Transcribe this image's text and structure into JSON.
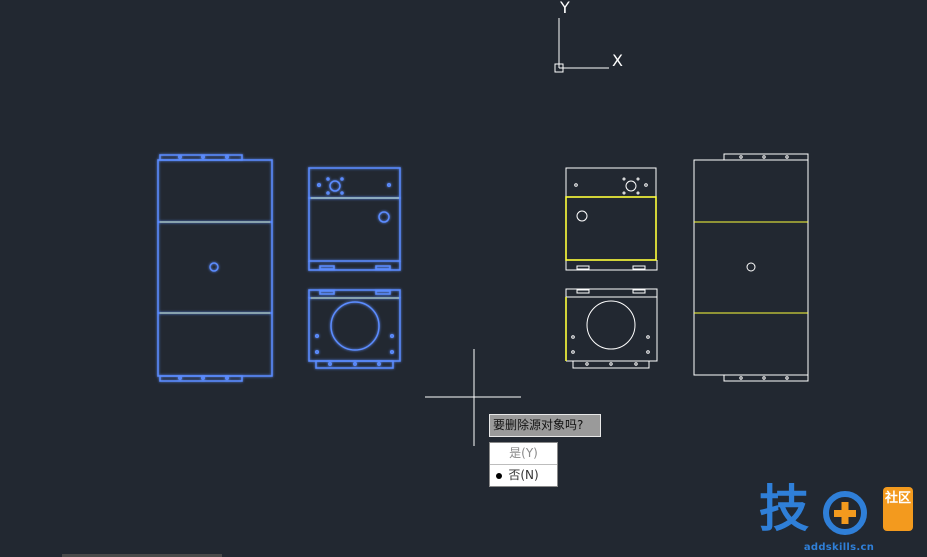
{
  "ucs": {
    "x_label": "X",
    "y_label": "Y"
  },
  "dialog": {
    "question": "要删除源对象吗?",
    "options": [
      {
        "label": "是(Y)",
        "selected": false
      },
      {
        "label": "否(N)",
        "selected": true
      }
    ]
  },
  "watermark": {
    "char": "技",
    "badge": "社区",
    "domain": "addskills.cn"
  },
  "colors": {
    "background": "#222831",
    "selected": "#5b8cff",
    "line": "#ffffff",
    "yellow": "#ffff3a"
  }
}
